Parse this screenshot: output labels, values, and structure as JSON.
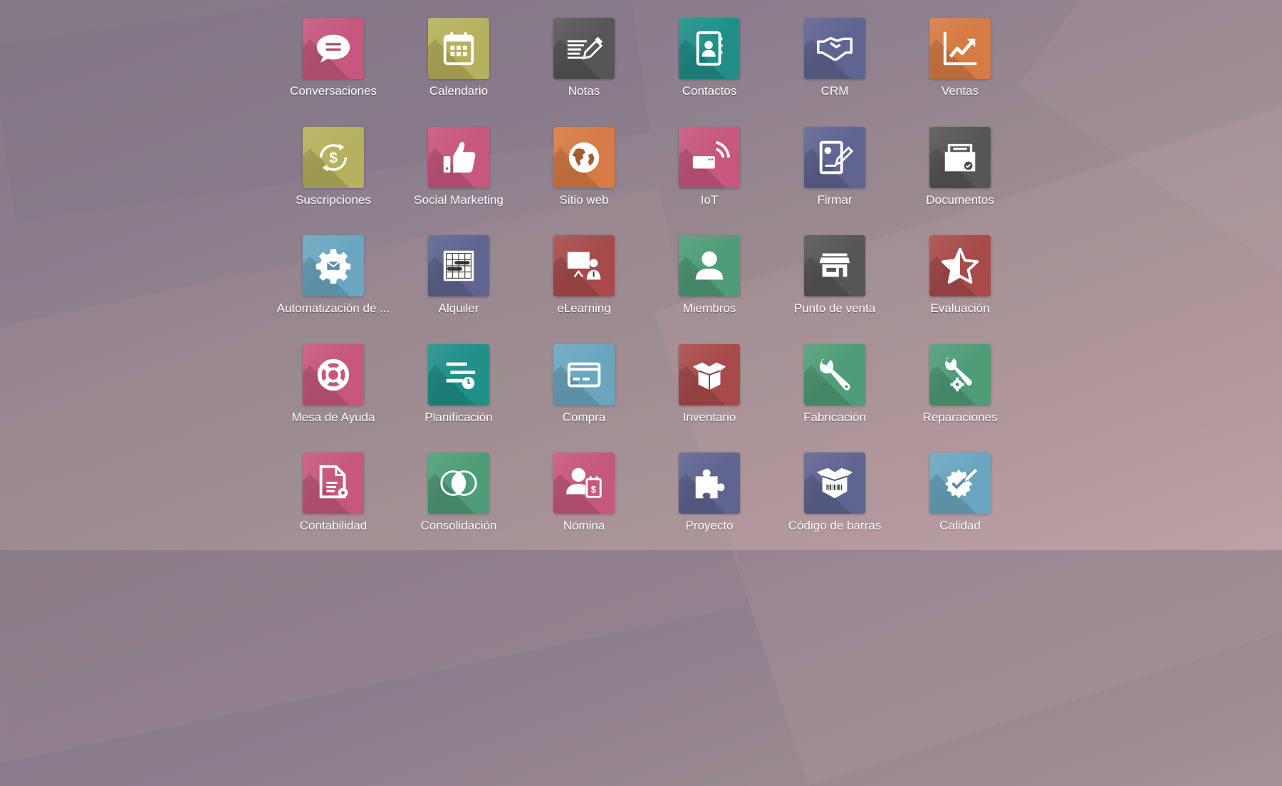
{
  "apps": [
    {
      "label": "Conversaciones",
      "icon": "chat-bubble-icon",
      "color": "#c6577d"
    },
    {
      "label": "Calendario",
      "icon": "calendar-icon",
      "color": "#b5b15c"
    },
    {
      "label": "Notas",
      "icon": "notes-pencil-icon",
      "color": "#565656"
    },
    {
      "label": "Contactos",
      "icon": "address-book-icon",
      "color": "#1f8f88"
    },
    {
      "label": "CRM",
      "icon": "handshake-icon",
      "color": "#5f6491"
    },
    {
      "label": "Ventas",
      "icon": "trend-chart-icon",
      "color": "#d77a43"
    },
    {
      "label": "Suscripciones",
      "icon": "recurring-dollar-icon",
      "color": "#b5b15c"
    },
    {
      "label": "Social Marketing",
      "icon": "thumbs-up-icon",
      "color": "#c6577d"
    },
    {
      "label": "Sitio web",
      "icon": "globe-icon",
      "color": "#d77a43"
    },
    {
      "label": "IoT",
      "icon": "iot-device-icon",
      "color": "#c6577d"
    },
    {
      "label": "Firmar",
      "icon": "sign-document-icon",
      "color": "#5f6491"
    },
    {
      "label": "Documentos",
      "icon": "document-box-icon",
      "color": "#565656"
    },
    {
      "label": "Automatización de ...",
      "icon": "gear-mail-icon",
      "color": "#6aa6c0"
    },
    {
      "label": "Alquiler",
      "icon": "gantt-icon",
      "color": "#5f6491"
    },
    {
      "label": "eLearning",
      "icon": "presentation-icon",
      "color": "#a84a4a"
    },
    {
      "label": "Miembros",
      "icon": "user-icon",
      "color": "#4f9c78"
    },
    {
      "label": "Punto de venta",
      "icon": "store-icon",
      "color": "#565656"
    },
    {
      "label": "Evaluación",
      "icon": "half-star-icon",
      "color": "#a84a4a"
    },
    {
      "label": "Mesa de Ayuda",
      "icon": "lifebuoy-icon",
      "color": "#c6577d"
    },
    {
      "label": "Planificación",
      "icon": "planning-clock-icon",
      "color": "#1f8f88"
    },
    {
      "label": "Compra",
      "icon": "credit-card-icon",
      "color": "#6aa6c0"
    },
    {
      "label": "Inventario",
      "icon": "open-box-icon",
      "color": "#a84a4a"
    },
    {
      "label": "Fabricación",
      "icon": "wrench-icon",
      "color": "#4f9c78"
    },
    {
      "label": "Reparaciones",
      "icon": "wrench-gear-icon",
      "color": "#4f9c78"
    },
    {
      "label": "Contabilidad",
      "icon": "document-gear-icon",
      "color": "#c6577d"
    },
    {
      "label": "Consolidación",
      "icon": "overlap-circles-icon",
      "color": "#4f9c78"
    },
    {
      "label": "Nómina",
      "icon": "user-payslip-icon",
      "color": "#c6577d"
    },
    {
      "label": "Proyecto",
      "icon": "puzzle-icon",
      "color": "#5f6491"
    },
    {
      "label": "Código de barras",
      "icon": "barcode-box-icon",
      "color": "#5f6491"
    },
    {
      "label": "Calidad",
      "icon": "quality-badge-icon",
      "color": "#6aa6c0"
    }
  ]
}
